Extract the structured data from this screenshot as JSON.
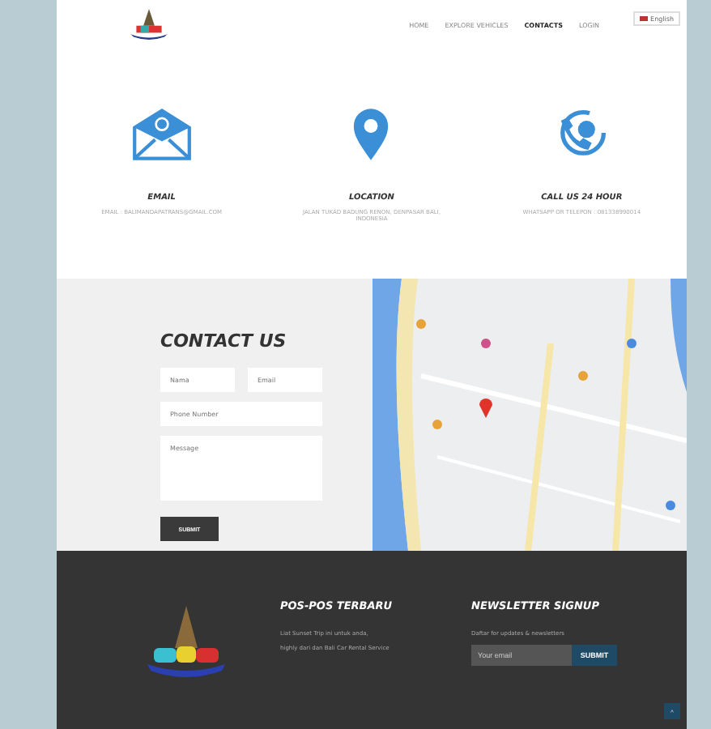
{
  "header": {
    "language": "English",
    "nav": [
      {
        "label": "HOME",
        "selected": false
      },
      {
        "label": "EXPLORE VEHICLES",
        "selected": false
      },
      {
        "label": "CONTACTS",
        "selected": true
      },
      {
        "label": "LOGIN",
        "selected": false
      }
    ]
  },
  "info": [
    {
      "kind": "email",
      "title": "EMAIL",
      "text": "EMAIL : BALIMANDAPATRANS@GMAIL.COM"
    },
    {
      "kind": "location",
      "title": "LOCATION",
      "text": "JALAN TUKAD BADUNG RENON, DENPASAR BALI, INDONESIA"
    },
    {
      "kind": "phone",
      "title": "CALL US 24 HOUR",
      "text": "WHATSAPP OR TELEPON : 081338990014"
    }
  ],
  "contact": {
    "title": "CONTACT US",
    "name": {
      "placeholder": "Nama"
    },
    "email": {
      "placeholder": "Email"
    },
    "phone": {
      "placeholder": "Phone Number"
    },
    "message": {
      "placeholder": "Message"
    },
    "submit": "SUBMIT"
  },
  "footer": {
    "posts_title": "POS-POS TERBARU",
    "posts": [
      "Liat Sunset Trip ini untuk anda,",
      "highly dari dan Bali Car Rental Service"
    ],
    "newsletter_title": "NEWSLETTER SIGNUP",
    "newsletter_text": "Daftar for updates & newsletters",
    "newsletter": {
      "placeholder": "Your email"
    },
    "newsletter_submit": "SUBMIT",
    "top": "^"
  }
}
